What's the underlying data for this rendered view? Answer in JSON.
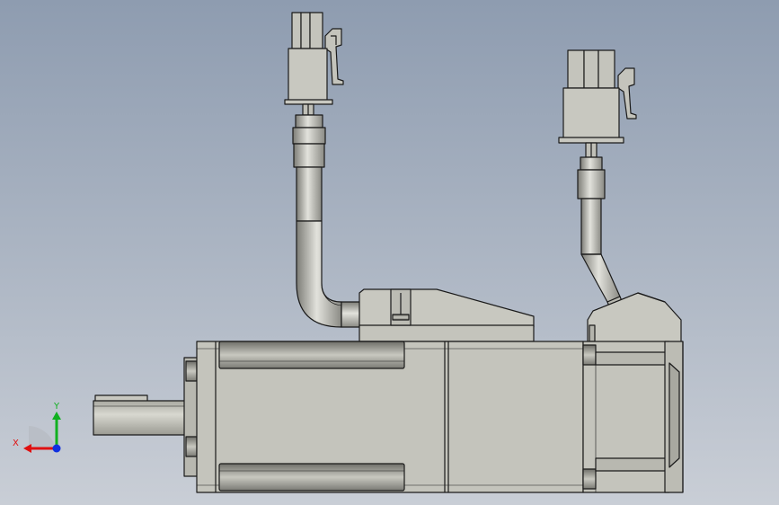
{
  "viewport": {
    "background_top": "#8e9cb0",
    "background_bottom": "#c9ced6"
  },
  "colors": {
    "body_fill": "#c4c4bc",
    "body_light": "#d2d2ca",
    "body_dark": "#9a9a92",
    "outline": "#1a1a1a",
    "cable_mid": "#d8d8d2",
    "cable_dark": "#7c7c76"
  },
  "triad": {
    "x_label": "X",
    "y_label": "Y",
    "x_color": "#e01010",
    "y_color": "#10b020",
    "z_color": "#1030e0"
  }
}
